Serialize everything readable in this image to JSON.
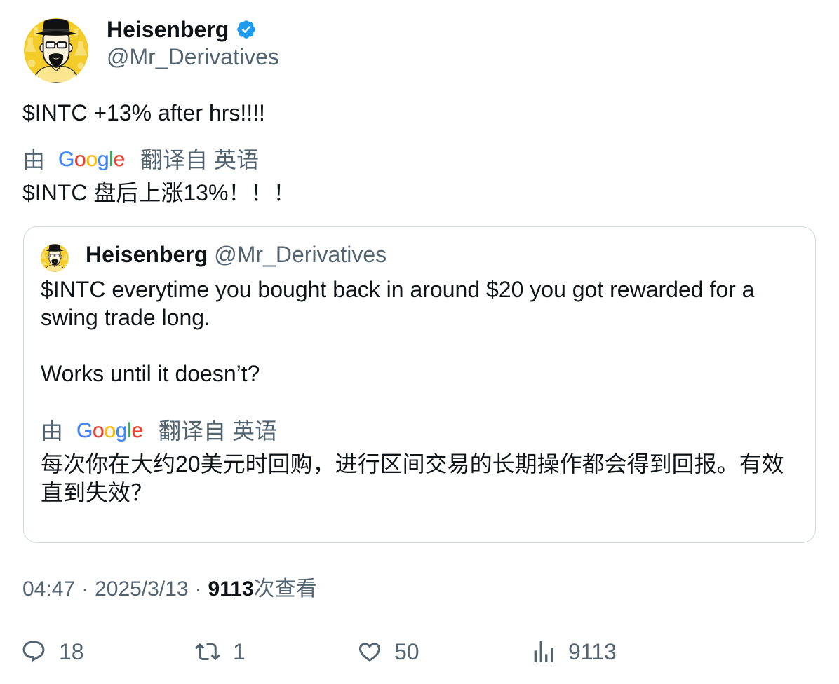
{
  "author": {
    "name": "Heisenberg",
    "handle": "@Mr_Derivatives",
    "verified": true,
    "avatar_icon": "heisenberg-avatar-icon",
    "badge_icon": "verified-badge-icon"
  },
  "tweet": {
    "text": "$INTC +13% after hrs!!!!",
    "translation": {
      "prefix": "由",
      "brand": "Google",
      "action": "翻译自",
      "language": "英语",
      "text": "$INTC 盘后上涨13%！！！"
    }
  },
  "quote": {
    "author": {
      "name": "Heisenberg",
      "handle": "@Mr_Derivatives",
      "avatar_icon": "heisenberg-avatar-icon"
    },
    "paragraphs": [
      {
        "lines": [
          "$INTC everytime you bought back in around $20 you got rewarded for a",
          "swing trade long."
        ]
      },
      {
        "lines": [
          "Works until it doesn’t?"
        ]
      }
    ],
    "translation": {
      "prefix": "由",
      "brand": "Google",
      "action": "翻译自",
      "language": "英语",
      "lines": [
        "每次你在大约20美元时回购，进行区间交易的长期操作都会得到回报。有效",
        "直到失效？"
      ]
    }
  },
  "meta": {
    "time": "04:47",
    "separator": "·",
    "date": "2025/3/13",
    "views_count": "9113",
    "views_label": "次查看"
  },
  "actions": {
    "reply": {
      "icon": "reply-icon",
      "count": "18"
    },
    "retweet": {
      "icon": "retweet-icon",
      "count": "1"
    },
    "like": {
      "icon": "heart-icon",
      "count": "50"
    },
    "views": {
      "icon": "views-icon",
      "count": "9113"
    }
  },
  "colors": {
    "text_primary": "#0f1419",
    "text_secondary": "#536471",
    "border": "#cfd9de",
    "verified": "#1d9bf0",
    "avatar_background": "#f4cc2a",
    "google_letters": [
      "#4285F4",
      "#EA4335",
      "#FBBC05",
      "#4285F4",
      "#34A853",
      "#EA4335"
    ]
  }
}
